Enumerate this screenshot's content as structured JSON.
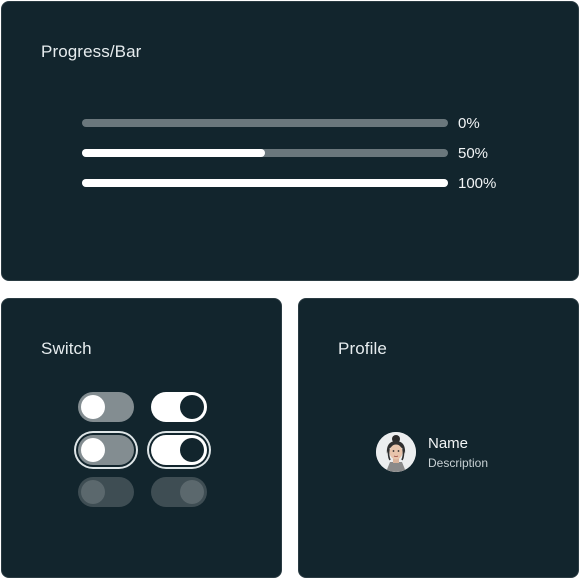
{
  "progress_card": {
    "title": "Progress/Bar",
    "bars": [
      {
        "label": "0%",
        "value": 0
      },
      {
        "label": "50%",
        "value": 0.5
      },
      {
        "label": "100%",
        "value": 1
      }
    ]
  },
  "switch_card": {
    "title": "Switch",
    "rows": [
      {
        "state": "default",
        "switches": [
          {
            "on": false
          },
          {
            "on": true
          }
        ]
      },
      {
        "state": "focused",
        "switches": [
          {
            "on": false
          },
          {
            "on": true
          }
        ]
      },
      {
        "state": "disabled",
        "switches": [
          {
            "on": false
          },
          {
            "on": true
          }
        ]
      }
    ]
  },
  "profile_card": {
    "title": "Profile",
    "name": "Name",
    "description": "Description",
    "avatar_icon": "person-avatar"
  },
  "colors": {
    "card_background": "#12252d",
    "track": "#6a777c",
    "fill": "#ffffff",
    "text": "#e6ecee"
  }
}
